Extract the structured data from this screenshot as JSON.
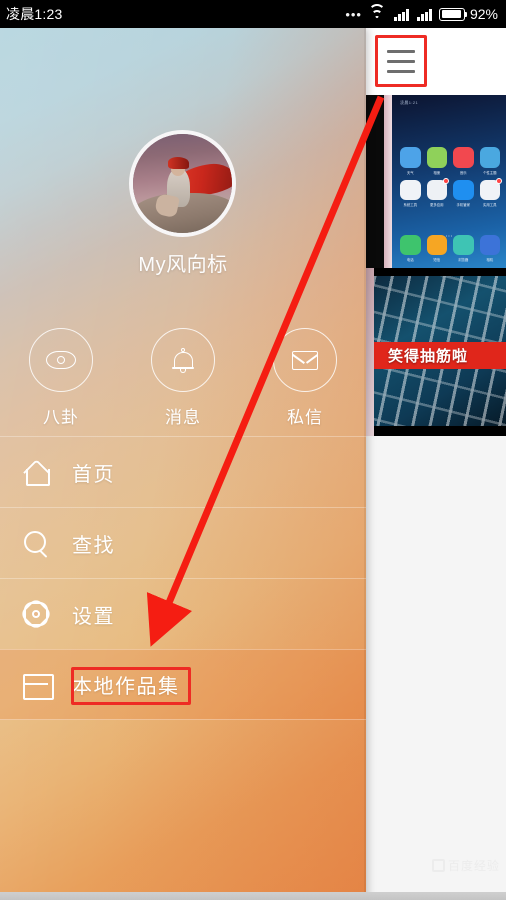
{
  "status_bar": {
    "time": "凌晨1:23",
    "dots": "•••",
    "wifi_icon": "wifi-icon",
    "signal_icon_1": "signal-bars-icon",
    "signal_icon_2": "signal-bars-icon",
    "battery_icon": "battery-icon",
    "battery_percent": "92%"
  },
  "right_panel": {
    "menu_button_icon": "hamburger-menu-icon",
    "thumbnails": [
      {
        "name": "thumbnail-homescreen",
        "status_text": "凌晨1:21",
        "caption": ""
      },
      {
        "name": "thumbnail-calligraphy",
        "banner_text": "笑得抽筋啦"
      }
    ],
    "homescreen_icons": [
      {
        "label": "天气",
        "color": "#4da3e8",
        "badge": false
      },
      {
        "label": "相册",
        "color": "#8fd15a",
        "badge": false
      },
      {
        "label": "音乐",
        "color": "#f2484f",
        "badge": false
      },
      {
        "label": "个性主题",
        "color": "#4aa8e0",
        "badge": false
      },
      {
        "label": "系统工具",
        "color": "#f0f3f7",
        "badge": false
      },
      {
        "label": "更多应用",
        "color": "#eef1f5",
        "badge": true
      },
      {
        "label": "手机管家",
        "color": "#1f8ff0",
        "badge": false
      },
      {
        "label": "实用工具",
        "color": "#f0f3f7",
        "badge": true
      }
    ],
    "dock_icons": [
      {
        "label": "电话",
        "color": "#3ec46d"
      },
      {
        "label": "短信",
        "color": "#f6a623"
      },
      {
        "label": "浏览器",
        "color": "#3ec4b4"
      },
      {
        "label": "相机",
        "color": "#3c73d8"
      }
    ],
    "page_dots": "• • •",
    "watermark": "百度经验"
  },
  "drawer": {
    "profile": {
      "avatar_icon": "user-avatar",
      "username": "My风向标"
    },
    "quick_actions": [
      {
        "label": "八卦",
        "icon": "eye-icon"
      },
      {
        "label": "消息",
        "icon": "bell-icon"
      },
      {
        "label": "私信",
        "icon": "envelope-icon"
      }
    ],
    "menu_items": [
      {
        "label": "首页",
        "icon": "home-icon",
        "active": false
      },
      {
        "label": "查找",
        "icon": "search-icon",
        "active": false
      },
      {
        "label": "设置",
        "icon": "gear-icon",
        "active": false
      },
      {
        "label": "本地作品集",
        "icon": "folder-icon",
        "active": true
      }
    ]
  },
  "annotations": {
    "highlight_color": "#ee2b24",
    "arrow_color": "#f51d12",
    "arrow_label": "red-pointer-arrow"
  }
}
